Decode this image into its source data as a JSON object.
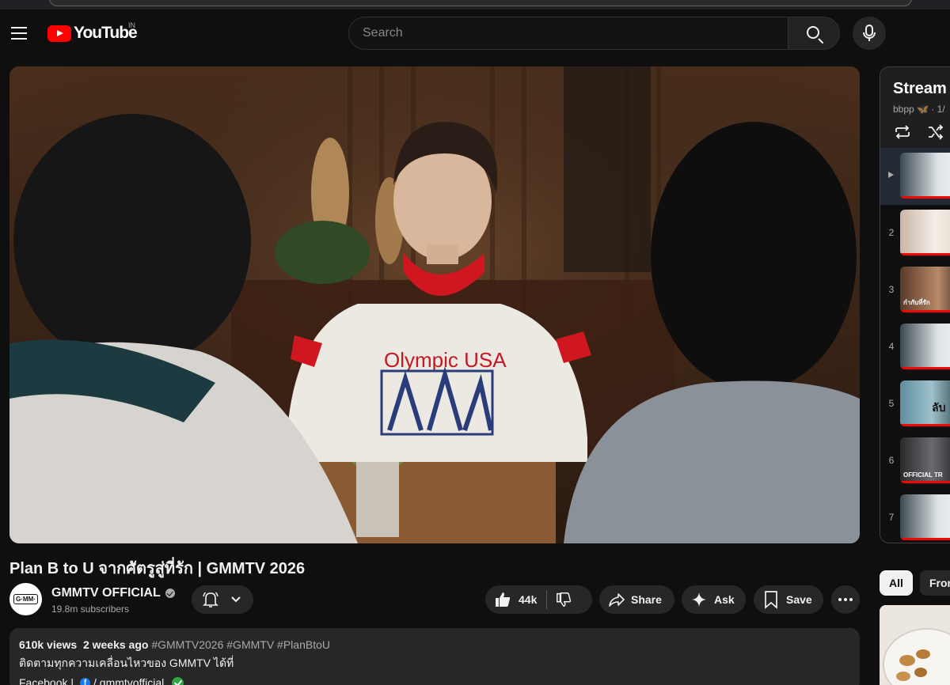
{
  "masthead": {
    "logo_text": "YouTube",
    "country_code": "IN",
    "search_placeholder": "Search",
    "icons": [
      "menu-icon",
      "youtube-logo",
      "search-icon",
      "mic-icon"
    ]
  },
  "video": {
    "title": "Plan B to U จากศัตรูสู่ที่รัก | GMMTV 2026"
  },
  "channel": {
    "name": "GMMTV OFFICIAL",
    "subscribers": "19.8m subscribers",
    "avatar_text": "G·MM·"
  },
  "actions": {
    "like_count": "44k",
    "share_label": "Share",
    "ask_label": "Ask",
    "save_label": "Save"
  },
  "description": {
    "views": "610k views",
    "age": "2 weeks ago",
    "tags": "#GMMTV2026 #GMMTV #PlanBtoU",
    "line2": "ติดตามทุกความเคลื่อนไหวของ GMMTV ได้ที่",
    "line3_label": "Facebook |",
    "line3_handle": "/ gmmtvofficial"
  },
  "playlist": {
    "title": "Stream [",
    "subtitle": "bbpp 🦋 · 1/",
    "items": [
      {
        "index": "",
        "active": true,
        "thumb_text": ""
      },
      {
        "index": "2",
        "active": false,
        "thumb_text": ""
      },
      {
        "index": "3",
        "active": false,
        "thumb_text": "กำกับที่รัก"
      },
      {
        "index": "4",
        "active": false,
        "thumb_text": ""
      },
      {
        "index": "5",
        "active": false,
        "thumb_text": "ลับ"
      },
      {
        "index": "6",
        "active": false,
        "thumb_text": "OFFICIAL TR"
      },
      {
        "index": "7",
        "active": false,
        "thumb_text": ""
      }
    ]
  },
  "chips": {
    "all": "All",
    "second": "Fron"
  },
  "colors": {
    "background": "#0f0f0f",
    "brand_red": "#ff0000",
    "pill_bg": "#272727",
    "text_secondary": "#aaaaaa"
  }
}
